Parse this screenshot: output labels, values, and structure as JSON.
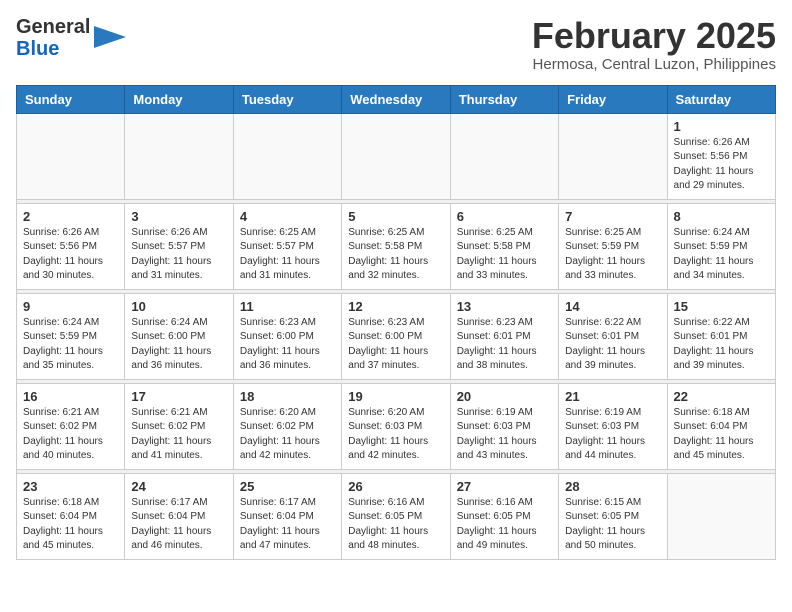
{
  "header": {
    "logo_general": "General",
    "logo_blue": "Blue",
    "month_year": "February 2025",
    "location": "Hermosa, Central Luzon, Philippines"
  },
  "weekdays": [
    "Sunday",
    "Monday",
    "Tuesday",
    "Wednesday",
    "Thursday",
    "Friday",
    "Saturday"
  ],
  "days": [
    {
      "date": "",
      "info": ""
    },
    {
      "date": "",
      "info": ""
    },
    {
      "date": "",
      "info": ""
    },
    {
      "date": "",
      "info": ""
    },
    {
      "date": "",
      "info": ""
    },
    {
      "date": "",
      "info": ""
    },
    {
      "date": "1",
      "info": "Sunrise: 6:26 AM\nSunset: 5:56 PM\nDaylight: 11 hours\nand 29 minutes."
    },
    {
      "date": "2",
      "info": "Sunrise: 6:26 AM\nSunset: 5:56 PM\nDaylight: 11 hours\nand 30 minutes."
    },
    {
      "date": "3",
      "info": "Sunrise: 6:26 AM\nSunset: 5:57 PM\nDaylight: 11 hours\nand 31 minutes."
    },
    {
      "date": "4",
      "info": "Sunrise: 6:25 AM\nSunset: 5:57 PM\nDaylight: 11 hours\nand 31 minutes."
    },
    {
      "date": "5",
      "info": "Sunrise: 6:25 AM\nSunset: 5:58 PM\nDaylight: 11 hours\nand 32 minutes."
    },
    {
      "date": "6",
      "info": "Sunrise: 6:25 AM\nSunset: 5:58 PM\nDaylight: 11 hours\nand 33 minutes."
    },
    {
      "date": "7",
      "info": "Sunrise: 6:25 AM\nSunset: 5:59 PM\nDaylight: 11 hours\nand 33 minutes."
    },
    {
      "date": "8",
      "info": "Sunrise: 6:24 AM\nSunset: 5:59 PM\nDaylight: 11 hours\nand 34 minutes."
    },
    {
      "date": "9",
      "info": "Sunrise: 6:24 AM\nSunset: 5:59 PM\nDaylight: 11 hours\nand 35 minutes."
    },
    {
      "date": "10",
      "info": "Sunrise: 6:24 AM\nSunset: 6:00 PM\nDaylight: 11 hours\nand 36 minutes."
    },
    {
      "date": "11",
      "info": "Sunrise: 6:23 AM\nSunset: 6:00 PM\nDaylight: 11 hours\nand 36 minutes."
    },
    {
      "date": "12",
      "info": "Sunrise: 6:23 AM\nSunset: 6:00 PM\nDaylight: 11 hours\nand 37 minutes."
    },
    {
      "date": "13",
      "info": "Sunrise: 6:23 AM\nSunset: 6:01 PM\nDaylight: 11 hours\nand 38 minutes."
    },
    {
      "date": "14",
      "info": "Sunrise: 6:22 AM\nSunset: 6:01 PM\nDaylight: 11 hours\nand 39 minutes."
    },
    {
      "date": "15",
      "info": "Sunrise: 6:22 AM\nSunset: 6:01 PM\nDaylight: 11 hours\nand 39 minutes."
    },
    {
      "date": "16",
      "info": "Sunrise: 6:21 AM\nSunset: 6:02 PM\nDaylight: 11 hours\nand 40 minutes."
    },
    {
      "date": "17",
      "info": "Sunrise: 6:21 AM\nSunset: 6:02 PM\nDaylight: 11 hours\nand 41 minutes."
    },
    {
      "date": "18",
      "info": "Sunrise: 6:20 AM\nSunset: 6:02 PM\nDaylight: 11 hours\nand 42 minutes."
    },
    {
      "date": "19",
      "info": "Sunrise: 6:20 AM\nSunset: 6:03 PM\nDaylight: 11 hours\nand 42 minutes."
    },
    {
      "date": "20",
      "info": "Sunrise: 6:19 AM\nSunset: 6:03 PM\nDaylight: 11 hours\nand 43 minutes."
    },
    {
      "date": "21",
      "info": "Sunrise: 6:19 AM\nSunset: 6:03 PM\nDaylight: 11 hours\nand 44 minutes."
    },
    {
      "date": "22",
      "info": "Sunrise: 6:18 AM\nSunset: 6:04 PM\nDaylight: 11 hours\nand 45 minutes."
    },
    {
      "date": "23",
      "info": "Sunrise: 6:18 AM\nSunset: 6:04 PM\nDaylight: 11 hours\nand 45 minutes."
    },
    {
      "date": "24",
      "info": "Sunrise: 6:17 AM\nSunset: 6:04 PM\nDaylight: 11 hours\nand 46 minutes."
    },
    {
      "date": "25",
      "info": "Sunrise: 6:17 AM\nSunset: 6:04 PM\nDaylight: 11 hours\nand 47 minutes."
    },
    {
      "date": "26",
      "info": "Sunrise: 6:16 AM\nSunset: 6:05 PM\nDaylight: 11 hours\nand 48 minutes."
    },
    {
      "date": "27",
      "info": "Sunrise: 6:16 AM\nSunset: 6:05 PM\nDaylight: 11 hours\nand 49 minutes."
    },
    {
      "date": "28",
      "info": "Sunrise: 6:15 AM\nSunset: 6:05 PM\nDaylight: 11 hours\nand 50 minutes."
    },
    {
      "date": "",
      "info": ""
    }
  ]
}
